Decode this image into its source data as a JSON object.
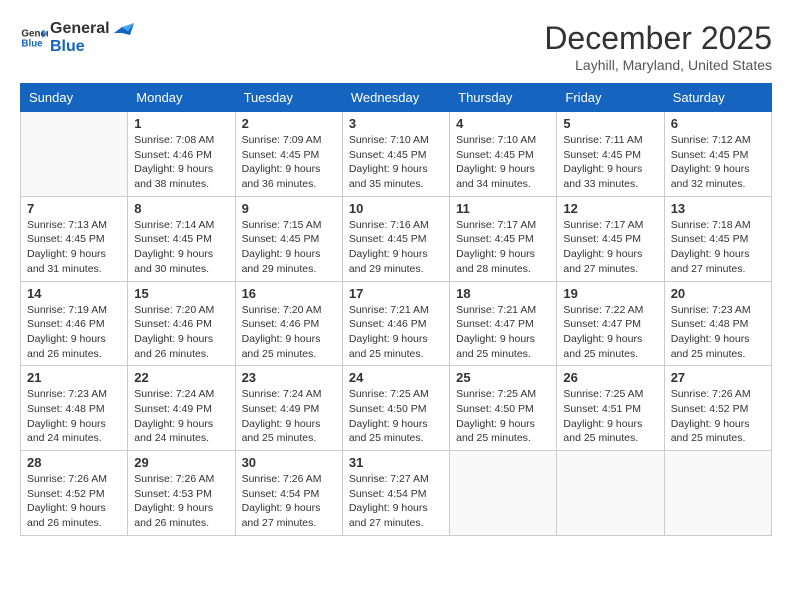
{
  "logo": {
    "line1": "General",
    "line2": "Blue"
  },
  "title": "December 2025",
  "location": "Layhill, Maryland, United States",
  "days_of_week": [
    "Sunday",
    "Monday",
    "Tuesday",
    "Wednesday",
    "Thursday",
    "Friday",
    "Saturday"
  ],
  "weeks": [
    [
      {
        "day": "",
        "sunrise": "",
        "sunset": "",
        "daylight": "",
        "empty": true
      },
      {
        "day": "1",
        "sunrise": "Sunrise: 7:08 AM",
        "sunset": "Sunset: 4:46 PM",
        "daylight": "Daylight: 9 hours and 38 minutes."
      },
      {
        "day": "2",
        "sunrise": "Sunrise: 7:09 AM",
        "sunset": "Sunset: 4:45 PM",
        "daylight": "Daylight: 9 hours and 36 minutes."
      },
      {
        "day": "3",
        "sunrise": "Sunrise: 7:10 AM",
        "sunset": "Sunset: 4:45 PM",
        "daylight": "Daylight: 9 hours and 35 minutes."
      },
      {
        "day": "4",
        "sunrise": "Sunrise: 7:10 AM",
        "sunset": "Sunset: 4:45 PM",
        "daylight": "Daylight: 9 hours and 34 minutes."
      },
      {
        "day": "5",
        "sunrise": "Sunrise: 7:11 AM",
        "sunset": "Sunset: 4:45 PM",
        "daylight": "Daylight: 9 hours and 33 minutes."
      },
      {
        "day": "6",
        "sunrise": "Sunrise: 7:12 AM",
        "sunset": "Sunset: 4:45 PM",
        "daylight": "Daylight: 9 hours and 32 minutes."
      }
    ],
    [
      {
        "day": "7",
        "sunrise": "Sunrise: 7:13 AM",
        "sunset": "Sunset: 4:45 PM",
        "daylight": "Daylight: 9 hours and 31 minutes."
      },
      {
        "day": "8",
        "sunrise": "Sunrise: 7:14 AM",
        "sunset": "Sunset: 4:45 PM",
        "daylight": "Daylight: 9 hours and 30 minutes."
      },
      {
        "day": "9",
        "sunrise": "Sunrise: 7:15 AM",
        "sunset": "Sunset: 4:45 PM",
        "daylight": "Daylight: 9 hours and 29 minutes."
      },
      {
        "day": "10",
        "sunrise": "Sunrise: 7:16 AM",
        "sunset": "Sunset: 4:45 PM",
        "daylight": "Daylight: 9 hours and 29 minutes."
      },
      {
        "day": "11",
        "sunrise": "Sunrise: 7:17 AM",
        "sunset": "Sunset: 4:45 PM",
        "daylight": "Daylight: 9 hours and 28 minutes."
      },
      {
        "day": "12",
        "sunrise": "Sunrise: 7:17 AM",
        "sunset": "Sunset: 4:45 PM",
        "daylight": "Daylight: 9 hours and 27 minutes."
      },
      {
        "day": "13",
        "sunrise": "Sunrise: 7:18 AM",
        "sunset": "Sunset: 4:45 PM",
        "daylight": "Daylight: 9 hours and 27 minutes."
      }
    ],
    [
      {
        "day": "14",
        "sunrise": "Sunrise: 7:19 AM",
        "sunset": "Sunset: 4:46 PM",
        "daylight": "Daylight: 9 hours and 26 minutes."
      },
      {
        "day": "15",
        "sunrise": "Sunrise: 7:20 AM",
        "sunset": "Sunset: 4:46 PM",
        "daylight": "Daylight: 9 hours and 26 minutes."
      },
      {
        "day": "16",
        "sunrise": "Sunrise: 7:20 AM",
        "sunset": "Sunset: 4:46 PM",
        "daylight": "Daylight: 9 hours and 25 minutes."
      },
      {
        "day": "17",
        "sunrise": "Sunrise: 7:21 AM",
        "sunset": "Sunset: 4:46 PM",
        "daylight": "Daylight: 9 hours and 25 minutes."
      },
      {
        "day": "18",
        "sunrise": "Sunrise: 7:21 AM",
        "sunset": "Sunset: 4:47 PM",
        "daylight": "Daylight: 9 hours and 25 minutes."
      },
      {
        "day": "19",
        "sunrise": "Sunrise: 7:22 AM",
        "sunset": "Sunset: 4:47 PM",
        "daylight": "Daylight: 9 hours and 25 minutes."
      },
      {
        "day": "20",
        "sunrise": "Sunrise: 7:23 AM",
        "sunset": "Sunset: 4:48 PM",
        "daylight": "Daylight: 9 hours and 25 minutes."
      }
    ],
    [
      {
        "day": "21",
        "sunrise": "Sunrise: 7:23 AM",
        "sunset": "Sunset: 4:48 PM",
        "daylight": "Daylight: 9 hours and 24 minutes."
      },
      {
        "day": "22",
        "sunrise": "Sunrise: 7:24 AM",
        "sunset": "Sunset: 4:49 PM",
        "daylight": "Daylight: 9 hours and 24 minutes."
      },
      {
        "day": "23",
        "sunrise": "Sunrise: 7:24 AM",
        "sunset": "Sunset: 4:49 PM",
        "daylight": "Daylight: 9 hours and 25 minutes."
      },
      {
        "day": "24",
        "sunrise": "Sunrise: 7:25 AM",
        "sunset": "Sunset: 4:50 PM",
        "daylight": "Daylight: 9 hours and 25 minutes."
      },
      {
        "day": "25",
        "sunrise": "Sunrise: 7:25 AM",
        "sunset": "Sunset: 4:50 PM",
        "daylight": "Daylight: 9 hours and 25 minutes."
      },
      {
        "day": "26",
        "sunrise": "Sunrise: 7:25 AM",
        "sunset": "Sunset: 4:51 PM",
        "daylight": "Daylight: 9 hours and 25 minutes."
      },
      {
        "day": "27",
        "sunrise": "Sunrise: 7:26 AM",
        "sunset": "Sunset: 4:52 PM",
        "daylight": "Daylight: 9 hours and 25 minutes."
      }
    ],
    [
      {
        "day": "28",
        "sunrise": "Sunrise: 7:26 AM",
        "sunset": "Sunset: 4:52 PM",
        "daylight": "Daylight: 9 hours and 26 minutes."
      },
      {
        "day": "29",
        "sunrise": "Sunrise: 7:26 AM",
        "sunset": "Sunset: 4:53 PM",
        "daylight": "Daylight: 9 hours and 26 minutes."
      },
      {
        "day": "30",
        "sunrise": "Sunrise: 7:26 AM",
        "sunset": "Sunset: 4:54 PM",
        "daylight": "Daylight: 9 hours and 27 minutes."
      },
      {
        "day": "31",
        "sunrise": "Sunrise: 7:27 AM",
        "sunset": "Sunset: 4:54 PM",
        "daylight": "Daylight: 9 hours and 27 minutes."
      },
      {
        "day": "",
        "empty": true
      },
      {
        "day": "",
        "empty": true
      },
      {
        "day": "",
        "empty": true
      }
    ]
  ]
}
